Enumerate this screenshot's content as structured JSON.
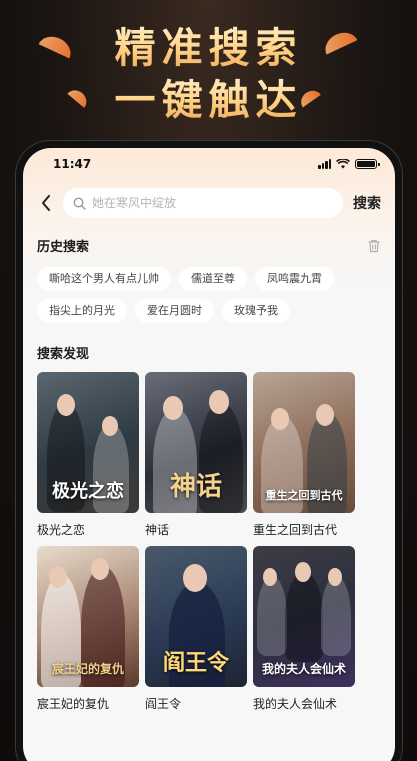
{
  "promo": {
    "line1": "精准搜索",
    "line2": "一键触达"
  },
  "status_bar": {
    "time": "11:47"
  },
  "search": {
    "placeholder": "她在寒风中绽放",
    "button_label": "搜索"
  },
  "history": {
    "title": "历史搜索",
    "tags": [
      "嘶哈这个男人有点儿帅",
      "儒道至尊",
      "凤鸣震九霄",
      "指尖上的月光",
      "爱在月圆时",
      "玫瑰予我"
    ]
  },
  "discover": {
    "title": "搜索发现",
    "items": [
      {
        "label": "极光之恋",
        "poster_title": "极光之恋"
      },
      {
        "label": "神话",
        "poster_title": "神话"
      },
      {
        "label": "重生之回到古代",
        "poster_title": "重生之回到古代"
      },
      {
        "label": "宸王妃的复仇",
        "poster_title": "宸王妃的复仇"
      },
      {
        "label": "阎王令",
        "poster_title": "阎王令"
      },
      {
        "label": "我的夫人会仙术",
        "poster_title": "我的夫人会仙术"
      }
    ]
  },
  "colors": {
    "accent_gold": "#ffd58a",
    "promo_bg": "#1a1412",
    "screen_bg": "#f7f7f7",
    "tag_bg": "#ffffff"
  },
  "icons": {
    "back": "chevron-left-icon",
    "search": "search-icon",
    "trash": "trash-icon",
    "signal": "signal-icon",
    "wifi": "wifi-icon",
    "battery": "battery-icon"
  }
}
